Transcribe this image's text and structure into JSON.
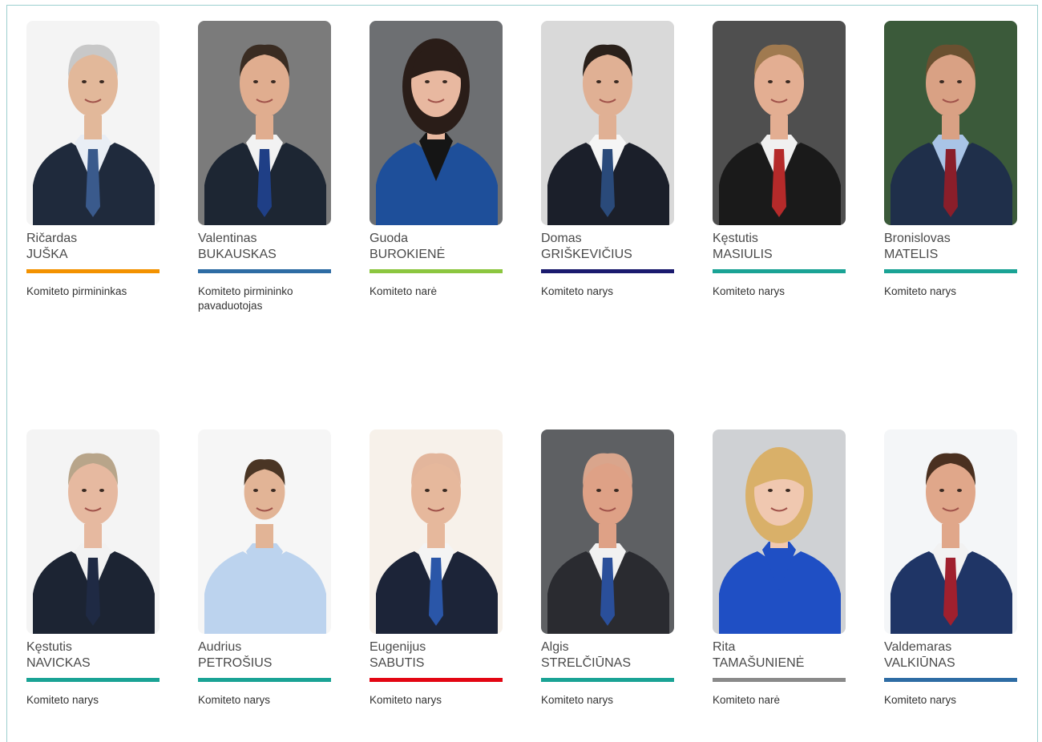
{
  "members": [
    {
      "first": "Ričardas",
      "last": "JUŠKA",
      "role": "Komiteto pirmininkas",
      "color": "#f39200",
      "bg": "#f4f4f4",
      "suit": "#1f2a3c",
      "shirt": "#e9eef5",
      "tie": "#3a5a8c",
      "hair": "#c8c8c8",
      "skin": "#e2b89a"
    },
    {
      "first": "Valentinas",
      "last": "BUKAUSKAS",
      "role": "Komiteto pirmininko pavaduotojas",
      "color": "#2e6ca4",
      "bg": "#7b7b7b",
      "suit": "#1d2633",
      "shirt": "#f2f2f2",
      "tie": "#1f3f86",
      "hair": "#3a2c22",
      "skin": "#e0ad8f"
    },
    {
      "first": "Guoda",
      "last": "BUROKIENĖ",
      "role": "Komiteto narė",
      "color": "#8cc63f",
      "bg": "#6d6f72",
      "suit": "#1e4f9a",
      "shirt": "#151515",
      "tie": "#151515",
      "hair": "#2a1d18",
      "skin": "#e8b8a0"
    },
    {
      "first": "Domas",
      "last": "GRIŠKEVIČIUS",
      "role": "Komiteto narys",
      "color": "#1a1a6e",
      "bg": "#d9d9d9",
      "suit": "#1b1f2a",
      "shirt": "#f5f5f5",
      "tie": "#2a4a7a",
      "hair": "#2a201a",
      "skin": "#e0b094"
    },
    {
      "first": "Kęstutis",
      "last": "MASIULIS",
      "role": "Komiteto narys",
      "color": "#1aa395",
      "bg": "#4f4f4f",
      "suit": "#1a1a1a",
      "shirt": "#f0f0f0",
      "tie": "#b52a2a",
      "hair": "#a07a50",
      "skin": "#e3ae92"
    },
    {
      "first": "Bronislovas",
      "last": "MATELIS",
      "role": "Komiteto narys",
      "color": "#1aa395",
      "bg": "#3b5a3a",
      "suit": "#1f2f4a",
      "shirt": "#a9c4e6",
      "tie": "#8a1e2a",
      "hair": "#6a5030",
      "skin": "#d9a184"
    },
    {
      "first": "Kęstutis",
      "last": "NAVICKAS",
      "role": "Komiteto narys",
      "color": "#1aa395",
      "bg": "#f4f4f4",
      "suit": "#1c2433",
      "shirt": "#f2f2f2",
      "tie": "#1f2a44",
      "hair": "#b8a58a",
      "skin": "#e6b9a0"
    },
    {
      "first": "Audrius",
      "last": "PETROŠIUS",
      "role": "Komiteto narys",
      "color": "#1aa395",
      "bg": "#f6f6f6",
      "suit": "#bcd3ee",
      "shirt": "#bcd3ee",
      "tie": "#bcd3ee",
      "hair": "#4a3524",
      "skin": "#e2b496"
    },
    {
      "first": "Eugenijus",
      "last": "SABUTIS",
      "role": "Komiteto narys",
      "color": "#e30613",
      "bg": "#f7f1ea",
      "suit": "#1c2438",
      "shirt": "#f4f4f4",
      "tie": "#2a56a8",
      "hair": "#e3b69c",
      "skin": "#e6b89c"
    },
    {
      "first": "Algis",
      "last": "STRELČIŪNAS",
      "role": "Komiteto narys",
      "color": "#1aa395",
      "bg": "#5e6063",
      "suit": "#2a2b30",
      "shirt": "#f1f1f1",
      "tie": "#2a4f9a",
      "hair": "#d9a58c",
      "skin": "#dea186"
    },
    {
      "first": "Rita",
      "last": "TAMAŠUNIENĖ",
      "role": "Komiteto narė",
      "color": "#8a8a8a",
      "bg": "#cfd1d4",
      "suit": "#1f4fc4",
      "shirt": "#1f4fc4",
      "tie": "#1f4fc4",
      "hair": "#d9b069",
      "skin": "#f0c8b0"
    },
    {
      "first": "Valdemaras",
      "last": "VALKIŪNAS",
      "role": "Komiteto narys",
      "color": "#2e6ca4",
      "bg": "#f4f6f8",
      "suit": "#1f3566",
      "shirt": "#f2f2f2",
      "tie": "#a0202e",
      "hair": "#4a3020",
      "skin": "#e0a78a"
    }
  ]
}
